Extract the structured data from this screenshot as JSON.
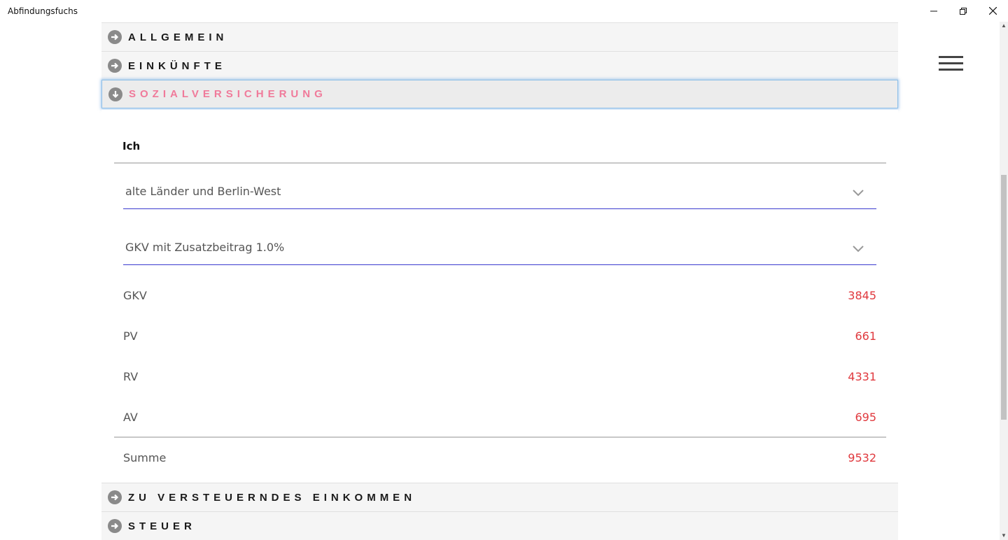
{
  "window": {
    "title": "Abfindungsfuchs",
    "minimize_icon": "minimize-icon",
    "maximize_icon": "restore-icon",
    "close_icon": "close-icon"
  },
  "menu": {
    "icon": "hamburger-menu-icon"
  },
  "sections": {
    "allgemein": {
      "label": "ALLGEMEIN",
      "icon": "arrow-right-circle-icon"
    },
    "einkuenfte": {
      "label": "EINKÜNFTE",
      "icon": "arrow-right-circle-icon"
    },
    "sozialversicherung": {
      "label": "SOZIALVERSICHERUNG",
      "icon": "arrow-down-circle-icon",
      "expanded": true
    },
    "zve": {
      "label": "ZU VERSTEUERNDES EINKOMMEN",
      "icon": "arrow-right-circle-icon"
    },
    "steuer": {
      "label": "STEUER",
      "icon": "arrow-right-circle-icon"
    }
  },
  "sozialversicherung_panel": {
    "subheading": "Ich",
    "region_select": {
      "value": "alte Länder und Berlin-West"
    },
    "insurance_select": {
      "value": "GKV mit Zusatzbeitrag 1.0%"
    },
    "rows": [
      {
        "label": "GKV",
        "value": "3845"
      },
      {
        "label": "PV",
        "value": "661"
      },
      {
        "label": "RV",
        "value": "4331"
      },
      {
        "label": "AV",
        "value": "695"
      }
    ],
    "total": {
      "label": "Summe",
      "value": "9532"
    }
  },
  "colors": {
    "active_section": "#f07a9a",
    "value_red": "#e0393e",
    "select_underline": "#3a3acf"
  }
}
